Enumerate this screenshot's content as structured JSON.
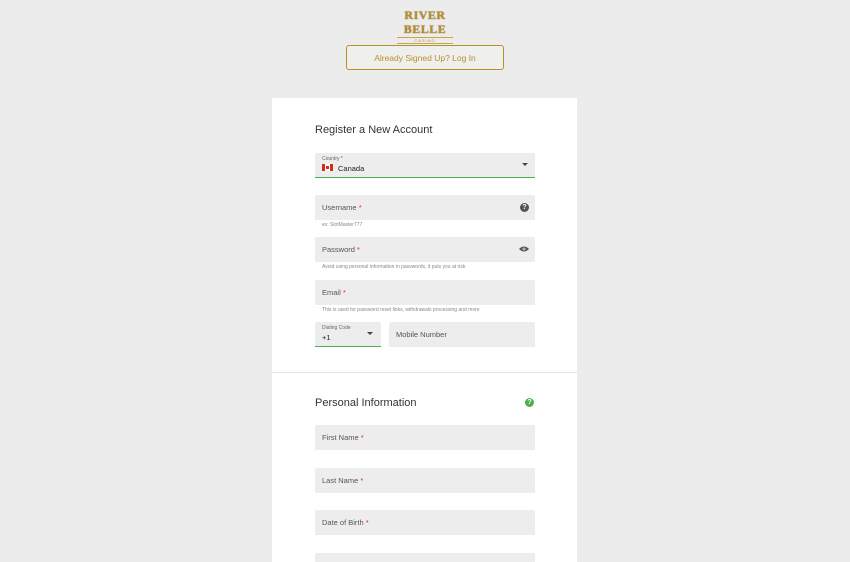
{
  "brand": {
    "logo_text": "RIVER BELLE",
    "logo_sub": "CASINO"
  },
  "header": {
    "login_label": "Already Signed Up? Log In"
  },
  "register": {
    "title": "Register a New Account",
    "country": {
      "label": "Country",
      "value": "Canada"
    },
    "username": {
      "label": "Username",
      "helper": "ex: SlotMaster777"
    },
    "password": {
      "label": "Password",
      "helper": "Avoid using personal information in passwords, it puts you at risk"
    },
    "email": {
      "label": "Email",
      "helper": "This is used for password reset links, withdrawals processing and more"
    },
    "dialing_code": {
      "label": "Dialing Code",
      "value": "+1"
    },
    "mobile": {
      "placeholder": "Mobile Number"
    }
  },
  "personal": {
    "title": "Personal Information",
    "first_name": {
      "label": "First Name"
    },
    "last_name": {
      "label": "Last Name"
    },
    "dob": {
      "label": "Date of Birth"
    }
  },
  "colors": {
    "accent_gold": "#b8902a",
    "accent_green": "#4caf50",
    "required_red": "#d32f2f"
  },
  "icons": [
    "help-icon",
    "eye-icon",
    "chevron-down-icon",
    "canada-flag-icon"
  ]
}
